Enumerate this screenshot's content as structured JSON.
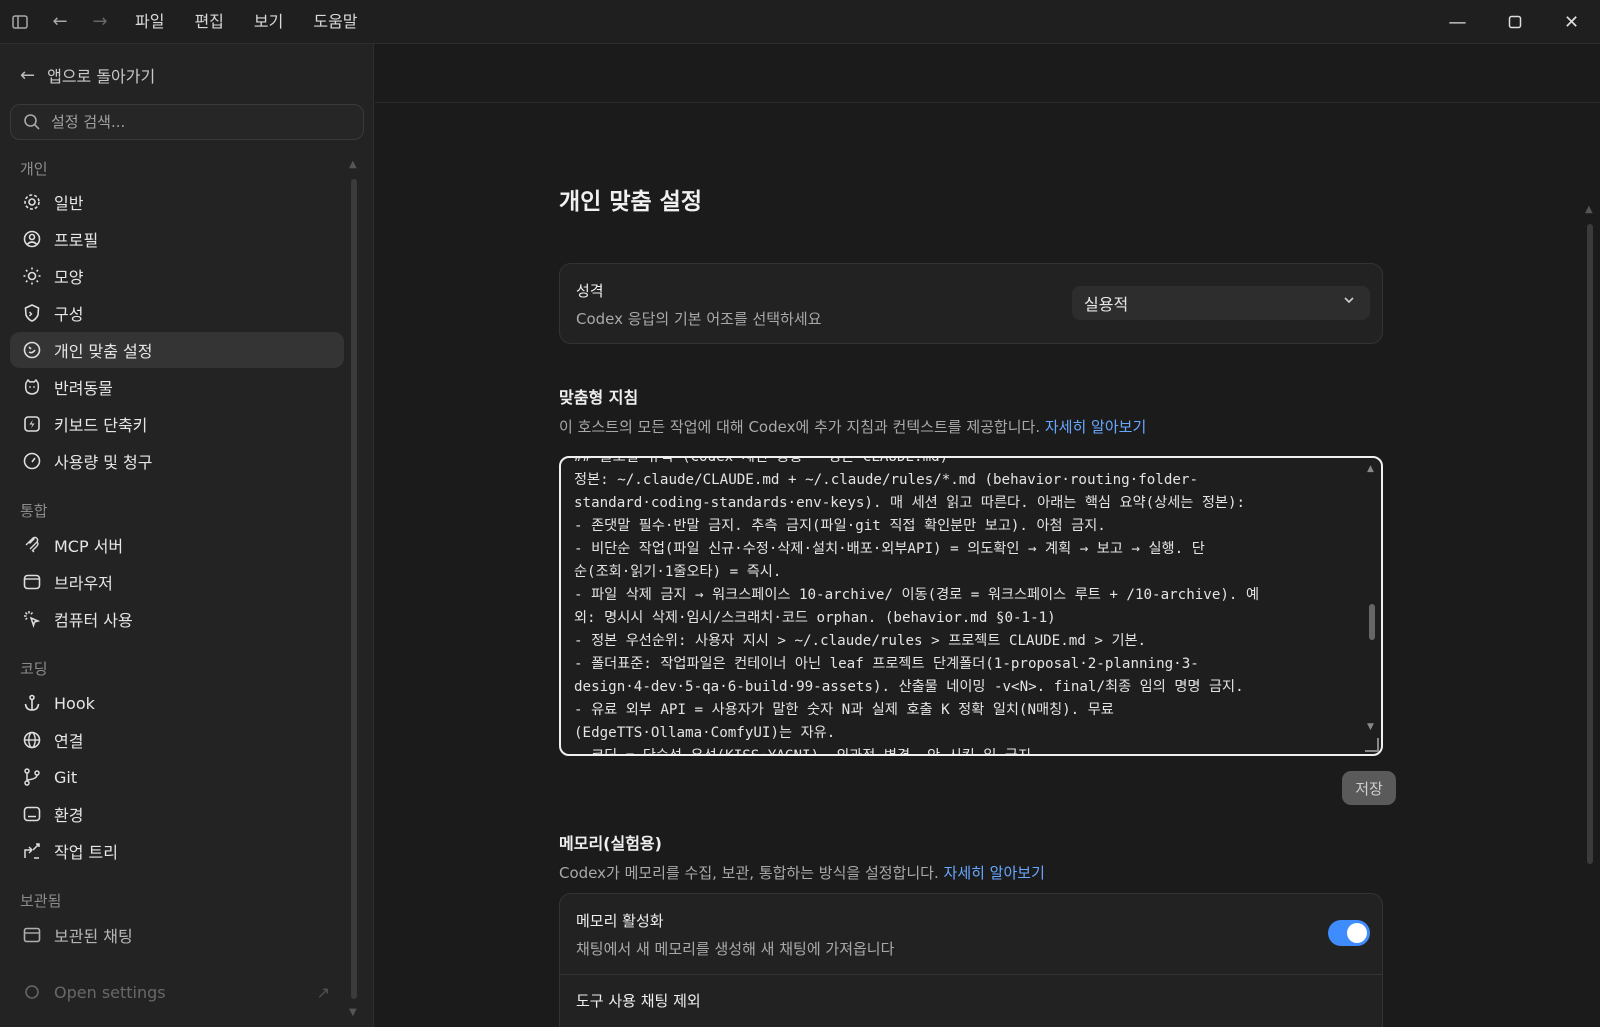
{
  "menu": {
    "items": [
      "파일",
      "편집",
      "보기",
      "도움말"
    ]
  },
  "sidebar": {
    "back_label": "앱으로 돌아가기",
    "search_placeholder": "설정 검색...",
    "sections": [
      {
        "title": "개인",
        "items": [
          "일반",
          "프로필",
          "모양",
          "구성",
          "개인 맞춤 설정",
          "반려동물",
          "키보드 단축키",
          "사용량 및 청구"
        ]
      },
      {
        "title": "통합",
        "items": [
          "MCP 서버",
          "브라우저",
          "컴퓨터 사용"
        ]
      },
      {
        "title": "코딩",
        "items": [
          "Hook",
          "연결",
          "Git",
          "환경",
          "작업 트리"
        ]
      },
      {
        "title": "보관됨",
        "items": [
          "보관된 채팅"
        ]
      }
    ],
    "footer_label": "Open settings"
  },
  "main": {
    "page_title": "개인 맞춤 설정",
    "personality": {
      "title": "성격",
      "desc": "Codex 응답의 기본 어조를 선택하세요",
      "selected": "실용적"
    },
    "instructions": {
      "title": "맞춤형 지침",
      "desc": "이 호스트의 모든 작업에 대해 Codex에 추가 지침과 컨텍스트를 제공합니다.",
      "link": "자세히 알아보기",
      "lines": [
        "## 글로벌 규칙 (Codex 세션 공통 · 정본 CLAUDE.md)",
        "정본: ~/.claude/CLAUDE.md + ~/.claude/rules/*.md (behavior·routing·folder-",
        "standard·coding-standards·env-keys). 매 세션 읽고 따른다. 아래는 핵심 요약(상세는 정본):",
        "- 존댓말 필수·반말 금지. 추측 금지(파일·git 직접 확인분만 보고). 아첨 금지.",
        "- 비단순 작업(파일 신규·수정·삭제·설치·배포·외부API) = 의도확인 → 계획 → 보고 → 실행. 단",
        "순(조회·읽기·1줄오타) = 즉시.",
        "- 파일 삭제 금지 → 워크스페이스 10-archive/ 이동(경로 = 워크스페이스 루트 + /10-archive). 예",
        "외: 명시시 삭제·임시/스크래치·코드 orphan. (behavior.md §0-1-1)",
        "- 정본 우선순위: 사용자 지시 > ~/.claude/rules > 프로젝트 CLAUDE.md > 기본.",
        "- 폴더표준: 작업파일은 컨테이너 아닌 leaf 프로젝트 단계폴더(1-proposal·2-planning·3-",
        "design·4-dev·5-qa·6-build·99-assets). 산출물 네이밍 -v<N>. final/최종 임의 명명 금지.",
        "- 유료 외부 API = 사용자가 말한 숫자 N과 실제 호출 K 정확 일치(N매칭). 무료",
        "(EdgeTTS·Ollama·ComfyUI)는 자유.",
        "- 코딩 = 단순성 우선(KISS·YAGNI). 외과적 변경. 안 시킨 일 금지."
      ],
      "save_label": "저장"
    },
    "memory": {
      "title": "메모리(실험용)",
      "desc": "Codex가 메모리를 수집, 보관, 통합하는 방식을 설정합니다.",
      "link": "자세히 알아보기",
      "enable_title": "메모리 활성화",
      "enable_desc": "채팅에서 새 메모리를 생성해 새 채팅에 가져옵니다",
      "enabled": true,
      "exclude_title": "도구 사용 채팅 제외"
    }
  },
  "colors": {
    "accent": "#3f8cff",
    "link": "#69a7ff"
  }
}
